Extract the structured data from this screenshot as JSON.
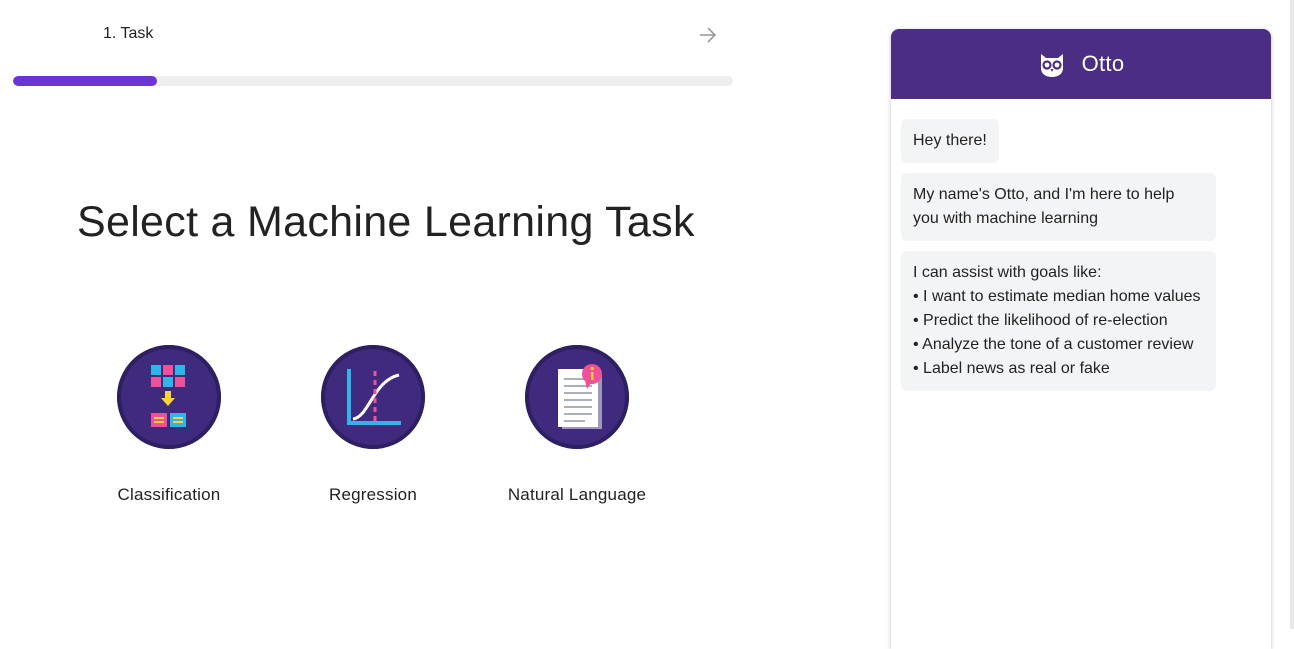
{
  "stepper": {
    "step_label": "1. Task",
    "progress_fraction": 0.2
  },
  "main": {
    "title": "Select a Machine Learning Task",
    "tasks": [
      {
        "label": "Classification",
        "icon": "classification-icon"
      },
      {
        "label": "Regression",
        "icon": "regression-icon"
      },
      {
        "label": "Natural Language",
        "icon": "natural-language-icon"
      }
    ]
  },
  "chat": {
    "title": "Otto",
    "header_icon": "owl-icon",
    "messages": {
      "greeting": "Hey there!",
      "intro": "My name's Otto, and I'm here to help you with machine learning",
      "goals_heading": "I can assist with goals like:",
      "goals": [
        "• I want to estimate median home values",
        "• Predict the likelihood of re-election",
        "• Analyze the tone of a customer review",
        "• Label news as real or fake"
      ]
    }
  },
  "colors": {
    "accent": "#6a34d6",
    "header": "#4b2d84",
    "icon_circle": "#3f2a7e",
    "bubble": "#f3f4f6"
  }
}
